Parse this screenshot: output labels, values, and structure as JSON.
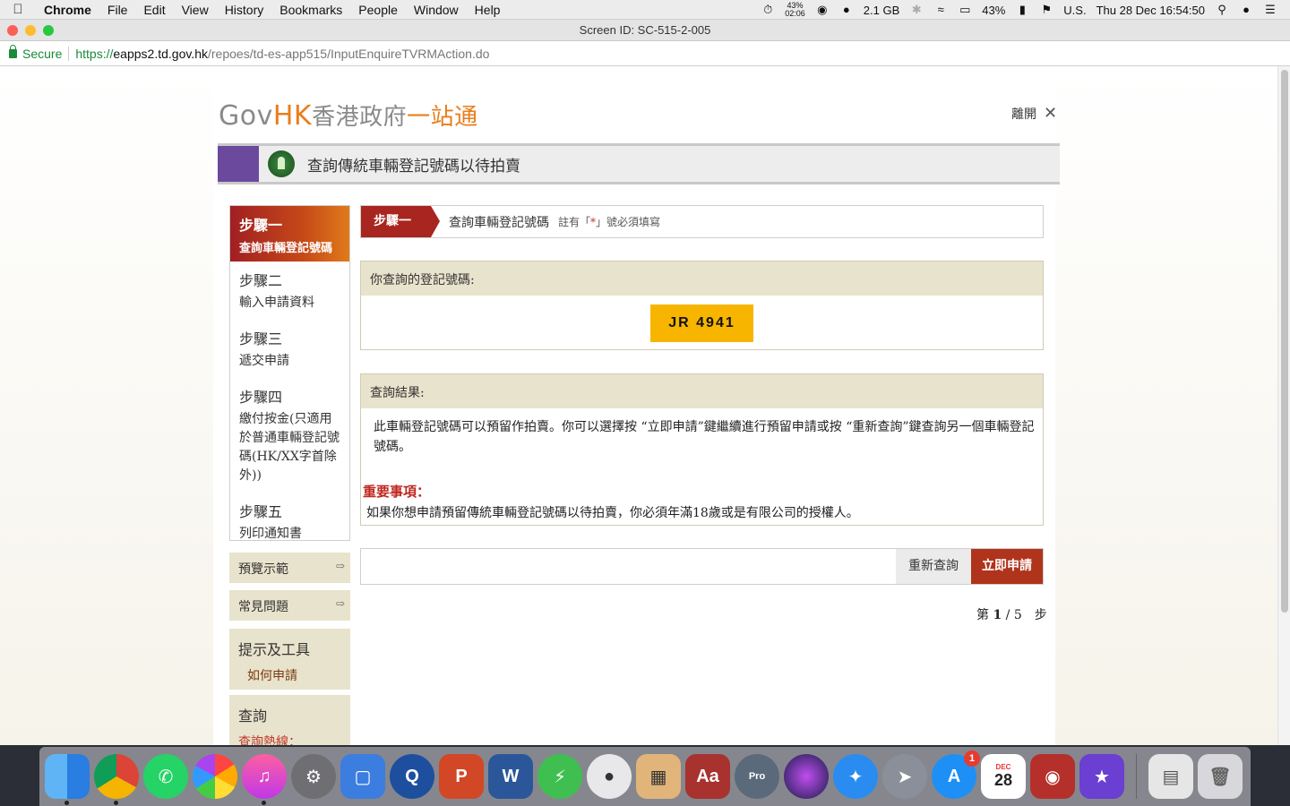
{
  "menubar": {
    "app": "Chrome",
    "items": [
      "File",
      "Edit",
      "View",
      "History",
      "Bookmarks",
      "People",
      "Window",
      "Help"
    ],
    "status": {
      "cpu_pct": "43%",
      "cpu_time": "02:06",
      "memory": "2.1 GB",
      "battery": "43%",
      "input_source": "U.S.",
      "clock": "Thu 28 Dec  16:54:50"
    }
  },
  "window": {
    "title": "Screen ID: SC-515-2-005"
  },
  "address": {
    "secure_label": "Secure",
    "url_proto": "https://",
    "url_host": "eapps2.td.gov.hk",
    "url_path": "/repoes/td-es-app515/InputEnquireTVRMAction.do"
  },
  "header": {
    "logo_gov": "Gov",
    "logo_hk": "HK",
    "logo_zh1": "香港政府",
    "logo_zh2": "一站通",
    "leave_label": "離開",
    "banner_title": "查詢傳統車輛登記號碼以待拍賣"
  },
  "sidebar": {
    "steps": [
      {
        "num": "步驟一",
        "text": "查詢車輛登記號碼"
      },
      {
        "num": "步驟二",
        "text": "輸入申請資料"
      },
      {
        "num": "步驟三",
        "text": "遞交申請"
      },
      {
        "num": "步驟四",
        "text": "繳付按金(只適用於普通車輛登記號碼(HK/XX字首除外))"
      },
      {
        "num": "步驟五",
        "text": "列印通知書"
      }
    ],
    "preview": "預覽示範",
    "faq": "常見問題",
    "tips_title": "提示及工具",
    "tips_link": "如何申請",
    "enquiry_title": "查詢",
    "enquiry_hotline": "查詢熱線："
  },
  "main": {
    "step_tag": "步驟一",
    "step_title": "查詢車輛登記號碼",
    "required_note_pre": "註有「",
    "required_star": "*",
    "required_note_post": "」號必須填寫",
    "plate_label": "你查詢的登記號碼:",
    "plate_value": "JR 4941",
    "result_label": "查詢結果:",
    "result_text": "此車輛登記號碼可以預留作拍賣。你可以選擇按 “立即申請”鍵繼續進行預留申請或按 “重新查詢”鍵查詢另一個車輛登記號碼。",
    "important_title": "重要事項：",
    "important_text": "如果你想申請預留傳統車輛登記號碼以待拍賣，你必須年滿18歲或是有限公司的授權人。",
    "btn_reenquire": "重新查詢",
    "btn_apply": "立即申請",
    "pager_pre": "第 ",
    "pager_current": "1",
    "pager_sep": " / 5　步"
  },
  "dock": {
    "calendar_month": "DEC",
    "calendar_day": "28",
    "appstore_badge": "1",
    "pro_label": "Pro"
  }
}
